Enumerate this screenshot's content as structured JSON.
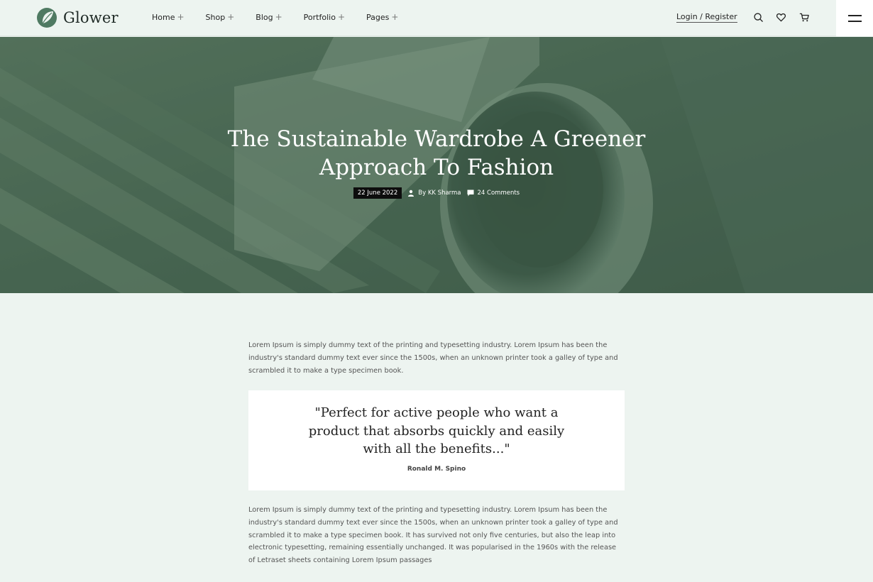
{
  "brand": {
    "name": "Glower"
  },
  "nav": {
    "items": [
      {
        "label": "Home",
        "suffix": "+"
      },
      {
        "label": "Shop",
        "suffix": "+"
      },
      {
        "label": "Blog",
        "suffix": "+"
      },
      {
        "label": "Portfolio",
        "suffix": "+"
      },
      {
        "label": "Pages",
        "suffix": "+"
      }
    ],
    "login_label": "Login / Register"
  },
  "header_icons": [
    "search-icon",
    "heart-icon",
    "cart-icon",
    "hamburger-menu-icon"
  ],
  "hero": {
    "title": "The Sustainable Wardrobe A Greener Approach To Fashion",
    "date": "22 June 2022",
    "author": "By KK Sharma",
    "comments": "24 Comments",
    "overlay_color": "#3f5e4b"
  },
  "article": {
    "paragraph_1": "Lorem Ipsum is simply dummy text of the printing and typesetting industry. Lorem Ipsum has been the industry's standard dummy text ever since the 1500s, when an unknown printer took a galley of type and scrambled it to make a type specimen book.",
    "quote": "\"Perfect for active people who want a product that absorbs quickly and easily with all the benefits...\"",
    "quote_author": "Ronald M. Spino",
    "paragraph_2": "Lorem Ipsum is simply dummy text of the printing and typesetting industry. Lorem Ipsum has been the industry's standard dummy text ever since the 1500s, when an unknown printer took a galley of type and scrambled it to make a type specimen book. It has survived not only five centuries, but also the leap into electronic typesetting, remaining essentially unchanged. It was popularised in the 1960s with the release of Letraset sheets containing Lorem Ipsum passages"
  },
  "colors": {
    "page_background": "#edf4f0",
    "brand_green": "#4f7a62",
    "text_dark": "#222222"
  }
}
